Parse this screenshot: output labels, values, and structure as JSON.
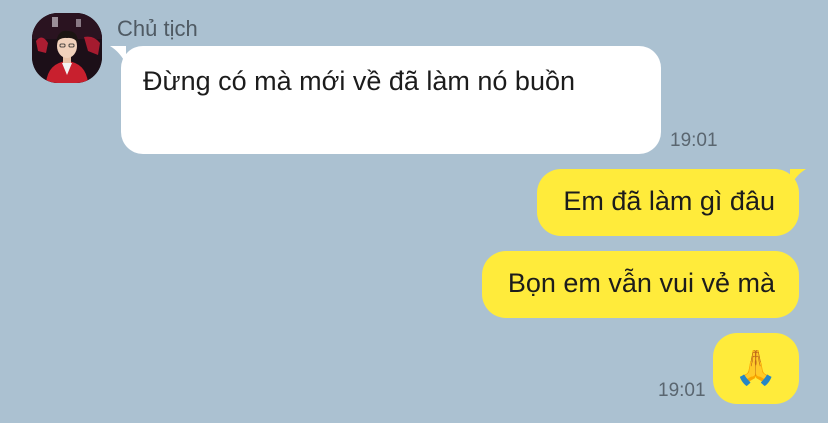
{
  "chat": {
    "incoming": {
      "sender_name": "Chủ tịch",
      "message": "Đừng có mà mới về đã làm nó buồn",
      "time": "19:01"
    },
    "outgoing": [
      {
        "message": "Em đã làm gì đâu"
      },
      {
        "message": "Bọn em vẫn vui vẻ mà"
      },
      {
        "message": "🙏"
      }
    ],
    "outgoing_time": "19:01"
  },
  "colors": {
    "background": "#abc1d1",
    "incoming_bubble": "#ffffff",
    "outgoing_bubble": "#ffeb3b"
  }
}
